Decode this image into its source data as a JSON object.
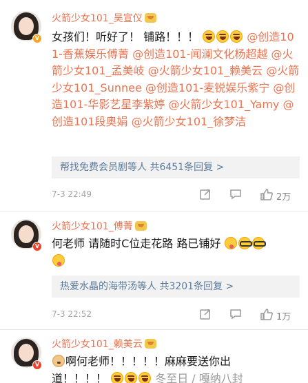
{
  "comments": [
    {
      "author": "火箭少女101_吴宣仪",
      "text_parts": [
        {
          "t": "女孩们！听好了！ 铺路！！！",
          "m": false
        }
      ],
      "text_after_emoji": [
        {
          "t": "@创造101-香蕉娱乐傅菁",
          "m": true
        },
        {
          "t": " ",
          "m": false
        },
        {
          "t": "@创造101-闻澜文化杨超越",
          "m": true
        },
        {
          "t": " ",
          "m": false
        },
        {
          "t": "@火箭少女101_孟美岐",
          "m": true
        },
        {
          "t": " ",
          "m": false
        },
        {
          "t": "@火箭少女101_赖美云",
          "m": true
        },
        {
          "t": " ",
          "m": false
        },
        {
          "t": "@火箭少女101_Sunnee",
          "m": true
        },
        {
          "t": " ",
          "m": false
        },
        {
          "t": "@创造101-麦锐娱乐紫宁",
          "m": true
        },
        {
          "t": " ",
          "m": false
        },
        {
          "t": "@创造101-华影艺星李紫婷",
          "m": true
        },
        {
          "t": " ",
          "m": false
        },
        {
          "t": "@火箭少女101_Yamy",
          "m": true
        },
        {
          "t": " ",
          "m": false
        },
        {
          "t": "@创造101段奥娟",
          "m": true
        },
        {
          "t": " ",
          "m": false
        },
        {
          "t": "@火箭少女101_徐梦洁",
          "m": true
        }
      ],
      "reply_prefix": "帮找免费会员剧等人",
      "reply_count": "共6451条回复 >",
      "time": "7-3 22:49",
      "likes": "2万"
    },
    {
      "author": "火箭少女101_傅菁",
      "text": "何老师 请随时C位走花路 路已铺好",
      "reply_prefix": "热爱水晶的海带汤等人",
      "reply_count": "共3201条回复 >",
      "time": "7-3 22:52",
      "likes": "1万"
    },
    {
      "author": "火箭少女101_赖美云",
      "text_line1": "啊何老师！！！！！麻麻要送你出",
      "text_line2": "道！！！！",
      "text_line2_tail": "冬至日 / 嘎纳八封"
    }
  ],
  "colors": {
    "accent_orange": "#eb7350",
    "reply_link": "#5a7a9a",
    "meta_gray": "#a3a3a3"
  }
}
